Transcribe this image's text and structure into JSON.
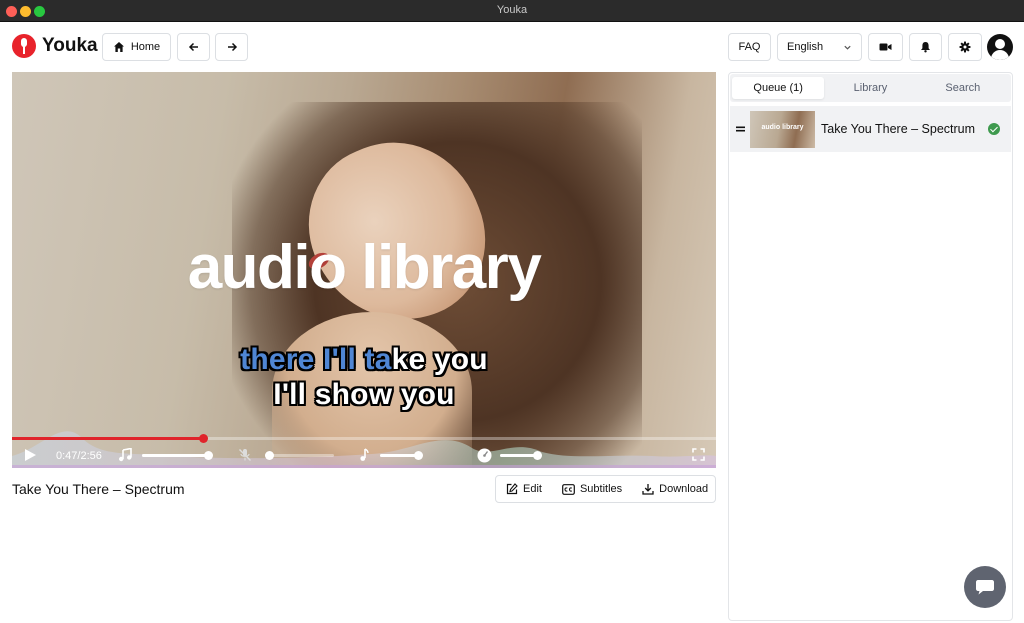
{
  "window": {
    "title": "Youka"
  },
  "header": {
    "logo_text": "Youka",
    "home_label": "Home",
    "faq_label": "FAQ",
    "language": "English"
  },
  "video": {
    "overlay_title": "audio library",
    "lyric_line1_sung": "there I'll ta",
    "lyric_line1_rest": "ke you",
    "lyric_line2": "I'll show you",
    "time": "0:47/2:56",
    "progress_fraction": 0.272,
    "music_volume_fraction": 0.96,
    "vocals_volume_fraction": 0.0,
    "pitch_fraction": 0.96,
    "speed_fraction": 0.96
  },
  "song": {
    "title": "Take You There – Spectrum",
    "actions": {
      "edit": "Edit",
      "subtitles": "Subtitles",
      "download": "Download"
    }
  },
  "panel": {
    "tabs": [
      "Queue (1)",
      "Library",
      "Search"
    ],
    "active_tab": 0,
    "queue": [
      {
        "title": "Take You There – Spectrum",
        "thumb_text": "audio library"
      }
    ]
  }
}
